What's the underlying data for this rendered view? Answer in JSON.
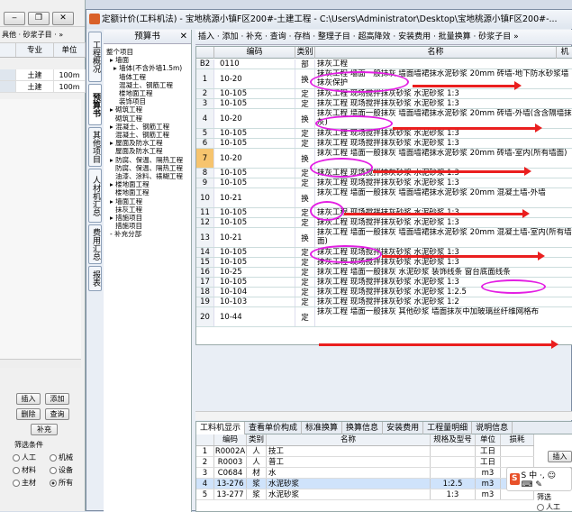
{
  "left_window": {
    "toolbar_text": "具他 · 砂浆子目 · »",
    "columns": [
      "",
      "专业",
      "单位"
    ],
    "rows": [
      {
        "specialty": "土建",
        "unit": "100m"
      },
      {
        "specialty": "土建",
        "unit": "100m"
      }
    ],
    "buttons": {
      "insert": "插入",
      "add": "添加",
      "delete": "删除",
      "query": "查询",
      "supplement": "补充"
    },
    "filter_label": "筛选条件",
    "radios": [
      {
        "label": "人工",
        "on": false
      },
      {
        "label": "机械",
        "on": false
      },
      {
        "label": "材料",
        "on": false
      },
      {
        "label": "设备",
        "on": false
      },
      {
        "label": "主材",
        "on": false
      },
      {
        "label": "所有",
        "on": true
      }
    ]
  },
  "main_window": {
    "title": "定额计价(工料机法) - 宝地桃源小镇F区200#-土建工程 - C:\\Users\\Administrator\\Desktop\\宝地桃源小镇F区200#-...",
    "vtabs": [
      "工程概况",
      "预算书",
      "其他项目",
      "人材机汇总",
      "费用汇总",
      "报表"
    ],
    "tree_header": "预算书",
    "tree_close": "✕",
    "tree_nodes": [
      "整个项目",
      "▸ 墙面",
      "▸ 墙体(不含外墙1.5m)",
      "墙体工程",
      "混凝土、钢筋工程",
      "楼地面工程",
      "装饰项目",
      "▸ 砌筑工程",
      "砌筑工程",
      "▸ 混凝土、钢筋工程",
      "混凝土、钢筋工程",
      "▸ 屋面及防水工程",
      "屋面及防水工程",
      "▸ 防腐、保温、隔热工程",
      "防腐、保温、隔热工程",
      "油漆、涂料、裱糊工程",
      "▸ 楼地面工程",
      "楼地面工程",
      "▸ 墙面工程",
      "抹灰工程",
      "▸ 措施项目",
      "措施项目",
      "- 补充分部"
    ],
    "toolbar": "插入 · 添加 · 补充 · 查询 · 存档 · 整理子目 · 超高降效 · 安装费用 · 批量换算 · 砂浆子目 »",
    "grid_headers": {
      "code": "编码",
      "type": "类别",
      "name": "名称",
      "extra": "机"
    },
    "grid_rows": [
      {
        "no": "B2",
        "code": "0110",
        "type": "部",
        "name": "抹灰工程"
      },
      {
        "no": "1",
        "code": "10-20",
        "type": "换",
        "name": "抹灰工程 墙面一般抹灰 墙面墙裙抹水泥砂浆 20mm 砖墙-地下防水砂浆墙抹灰保护"
      },
      {
        "no": "2",
        "code": "10-105",
        "type": "定",
        "name": "抹灰工程 现场搅拌抹灰砂浆 水泥砂浆 1:3"
      },
      {
        "no": "3",
        "code": "10-105",
        "type": "定",
        "name": "抹灰工程 现场搅拌抹灰砂浆 水泥砂浆 1:3"
      },
      {
        "no": "4",
        "code": "10-20",
        "type": "换",
        "name": "抹灰工程 墙面一般抹灰 墙面墙裙抹水泥砂浆 20mm 砖墙-外墙(含含隔墙抹灰)"
      },
      {
        "no": "5",
        "code": "10-105",
        "type": "定",
        "name": "抹灰工程 现场搅拌抹灰砂浆 水泥砂浆 1:3"
      },
      {
        "no": "6",
        "code": "10-105",
        "type": "定",
        "name": "抹灰工程 现场搅拌抹灰砂浆 水泥砂浆 1:3"
      },
      {
        "no": "7",
        "code": "10-20",
        "type": "换",
        "name": "抹灰工程 墙面一般抹灰 墙面墙裙抹水泥砂浆 20mm 砖墙-室内(所有墙面)"
      },
      {
        "no": "8",
        "code": "10-105",
        "type": "定",
        "name": "抹灰工程 现场搅拌抹灰砂浆 水泥砂浆 1:3"
      },
      {
        "no": "9",
        "code": "10-105",
        "type": "定",
        "name": "抹灰工程 现场搅拌抹灰砂浆 水泥砂浆 1:3"
      },
      {
        "no": "10",
        "code": "10-21",
        "type": "换",
        "name": "抹灰工程 墙面一般抹灰 墙面墙裙抹水泥砂浆 20mm 混凝土墙-外墙"
      },
      {
        "no": "11",
        "code": "10-105",
        "type": "定",
        "name": "抹灰工程 现场搅拌抹灰砂浆 水泥砂浆 1:3"
      },
      {
        "no": "12",
        "code": "10-105",
        "type": "定",
        "name": "抹灰工程 现场搅拌抹灰砂浆 水泥砂浆 1:3"
      },
      {
        "no": "13",
        "code": "10-21",
        "type": "换",
        "name": "抹灰工程 墙面一般抹灰 墙面墙裙抹水泥砂浆 20mm 混凝土墙-室内(所有墙面)"
      },
      {
        "no": "14",
        "code": "10-105",
        "type": "定",
        "name": "抹灰工程 现场搅拌抹灰砂浆 水泥砂浆 1:3"
      },
      {
        "no": "15",
        "code": "10-105",
        "type": "定",
        "name": "抹灰工程 现场搅拌抹灰砂浆 水泥砂浆 1:3"
      },
      {
        "no": "16",
        "code": "10-25",
        "type": "定",
        "name": "抹灰工程 墙面一般抹灰 水泥砂浆 装饰线条 窗台底面线条"
      },
      {
        "no": "17",
        "code": "10-105",
        "type": "定",
        "name": "抹灰工程 现场搅拌抹灰砂浆 水泥砂浆 1:3"
      },
      {
        "no": "18",
        "code": "10-104",
        "type": "定",
        "name": "抹灰工程 现场搅拌抹灰砂浆 水泥砂浆 1:2.5"
      },
      {
        "no": "19",
        "code": "10-103",
        "type": "定",
        "name": "抹灰工程 现场搅拌抹灰砂浆 水泥砂浆 1:2"
      },
      {
        "no": "20",
        "code": "10-44",
        "type": "定",
        "name": "抹灰工程 墙面一般抹灰 其他砂浆 墙面抹灰中加玻璃丝纤维网格布"
      }
    ],
    "bottom_tabs": [
      "工料机显示",
      "查看单价构成",
      "标准换算",
      "换算信息",
      "安装费用",
      "工程量明细",
      "说明信息"
    ],
    "bottom_headers": [
      "",
      "编码",
      "类别",
      "名称",
      "规格及型号",
      "单位",
      "损耗"
    ],
    "bottom_rows": [
      {
        "no": "1",
        "code": "R0002A",
        "type": "人",
        "name": "技工",
        "spec": "",
        "unit": "工日"
      },
      {
        "no": "2",
        "code": "R0003",
        "type": "人",
        "name": "普工",
        "spec": "",
        "unit": "工日"
      },
      {
        "no": "3",
        "code": "C0684",
        "type": "材",
        "name": "水",
        "spec": "",
        "unit": "m3"
      },
      {
        "no": "4",
        "code": "13-276",
        "type": "浆",
        "name": "水泥砂浆",
        "spec": "1:2.5",
        "unit": "m3"
      },
      {
        "no": "5",
        "code": "13-277",
        "type": "浆",
        "name": "水泥砂浆",
        "spec": "1:3",
        "unit": "m3"
      }
    ],
    "bottom_side_buttons": [
      "插入",
      "删除"
    ],
    "side_labels": [
      "筛选",
      "人工"
    ],
    "sogou": "S 中 ·, ☺ ⌨ ✎"
  },
  "colors": {
    "annotation_ellipse": "#e31fe3",
    "annotation_arrow": "#ea1f1f",
    "selected_row": "#f6c46e"
  }
}
